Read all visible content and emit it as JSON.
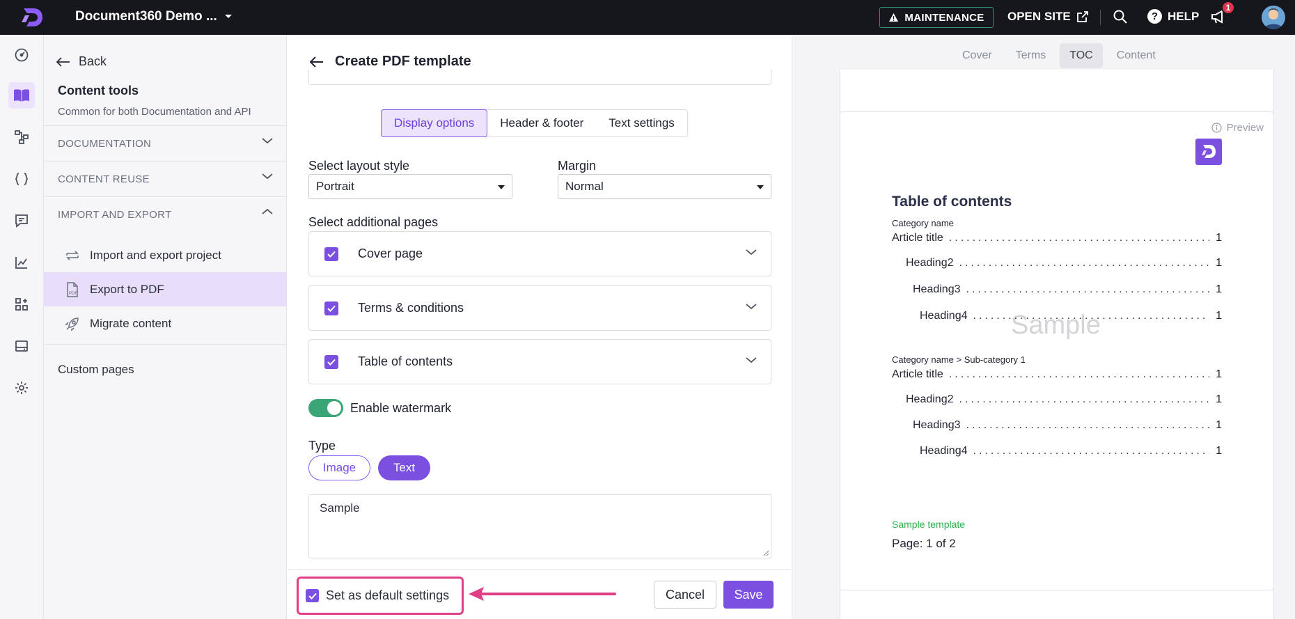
{
  "topbar": {
    "project_name": "Document360 Demo ...",
    "maintenance_label": "MAINTENANCE",
    "open_site_label": "OPEN SITE",
    "help_label": "HELP",
    "notification_count": "1"
  },
  "tools": {
    "back_label": "Back",
    "title": "Content tools",
    "subtitle": "Common for both Documentation and API",
    "sections": [
      {
        "label": "DOCUMENTATION"
      },
      {
        "label": "CONTENT REUSE"
      },
      {
        "label": "IMPORT AND EXPORT"
      }
    ],
    "items": [
      {
        "label": "Import and export project",
        "icon": "import-export-icon"
      },
      {
        "label": "Export to PDF",
        "icon": "pdf-file-icon"
      },
      {
        "label": "Migrate content",
        "icon": "rocket-icon"
      }
    ],
    "custom_pages_label": "Custom pages"
  },
  "form": {
    "title": "Create PDF template",
    "tabs": [
      "Display options",
      "Header & footer",
      "Text settings"
    ],
    "layout_label": "Select layout style",
    "layout_value": "Portrait",
    "margin_label": "Margin",
    "margin_value": "Normal",
    "additional_label": "Select additional pages",
    "pages": [
      {
        "label": "Cover page",
        "checked": true
      },
      {
        "label": "Terms & conditions",
        "checked": true
      },
      {
        "label": "Table of contents",
        "checked": true
      }
    ],
    "watermark_label": "Enable watermark",
    "type_label": "Type",
    "type_image": "Image",
    "type_text": "Text",
    "watermark_text": "Sample",
    "default_label": "Set as default settings",
    "cancel_label": "Cancel",
    "save_label": "Save"
  },
  "preview": {
    "tabs": [
      "Cover",
      "Terms",
      "TOC",
      "Content"
    ],
    "preview_label": "Preview",
    "toc_title": "Table of contents",
    "category1": "Category name",
    "category2": "Category name > Sub-category 1",
    "entries1": [
      {
        "label": "Article title",
        "page": "1"
      },
      {
        "label": "Heading2",
        "page": "1"
      },
      {
        "label": "Heading3",
        "page": "1"
      },
      {
        "label": "Heading4",
        "page": "1"
      }
    ],
    "entries2": [
      {
        "label": "Article title",
        "page": "1"
      },
      {
        "label": "Heading2",
        "page": "1"
      },
      {
        "label": "Heading3",
        "page": "1"
      },
      {
        "label": "Heading4",
        "page": "1"
      }
    ],
    "watermark": "Sample",
    "template_name": "Sample template",
    "page_number": "Page: 1 of 2"
  },
  "colors": {
    "accent": "#7b4fe0",
    "toggle_on": "#3aa576",
    "highlight": "#e03f86",
    "topbar": "#16161d"
  }
}
